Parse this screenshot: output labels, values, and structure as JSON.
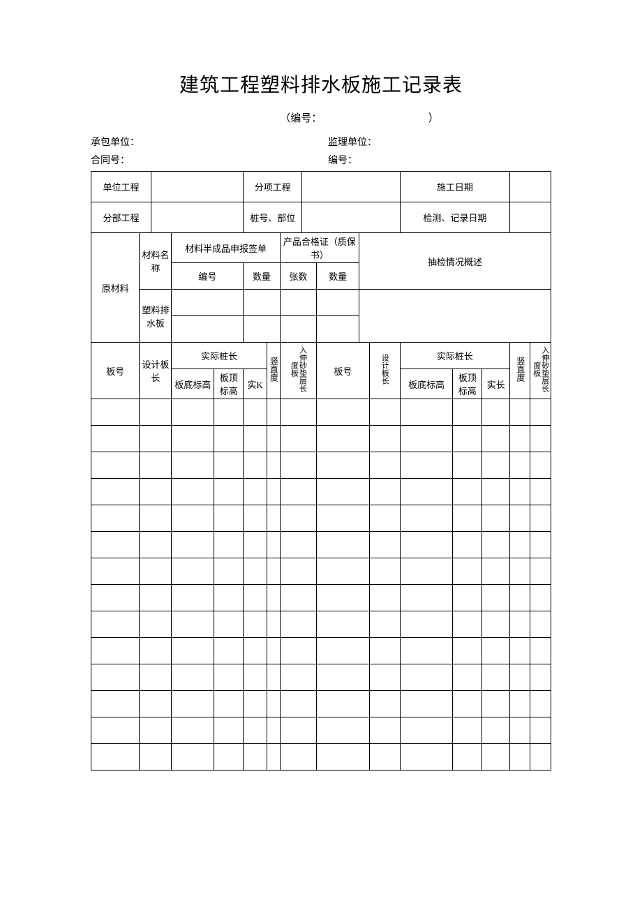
{
  "title": "建筑工程塑料排水板施工记录表",
  "docNumber": {
    "label": "编号：",
    "open": "（",
    "close": "）"
  },
  "meta": {
    "row1": {
      "leftLabel": "承包单位：",
      "rightLabel": "监理单位："
    },
    "row2": {
      "leftLabel": "合同号：",
      "rightLabel": "编号："
    }
  },
  "header": {
    "unitProject": "单位工程",
    "subProject": "分项工程",
    "consDate": "施工日期",
    "divProject": "分部工程",
    "pileLocation": "桩号、部位",
    "checkDate": "检测、记录日期"
  },
  "materials": {
    "rowLabel": "原材料",
    "matName": "材料名称",
    "matSemi": "材料半成品申报签单",
    "cert": "产品合格证（质保书）",
    "spot": "抽检情况概述",
    "numberLabel": "编号",
    "qtyLabel": "数量",
    "sheetsLabel": "张数",
    "qtyLabel2": "数量",
    "plasticBoard": "塑料排水板"
  },
  "columns": {
    "boardNo": "板号",
    "designLen": "设计板长",
    "actualPile": "实际桩长",
    "bottomElev": "板底标高",
    "topElev": "板顶标高",
    "actualK": "实K",
    "actualLen": "实长",
    "vertical": "竖直度",
    "extSand": "入伸砂垫层长度板",
    "boardNo2": "板号",
    "designBoardLen": "设计板长",
    "actualPile2": "实际桩长",
    "bottomElev2": "板底标高",
    "topElev2": "板顶标高",
    "vertical2": "竖直度",
    "extSand2": "入伸砂垫层长度板"
  }
}
